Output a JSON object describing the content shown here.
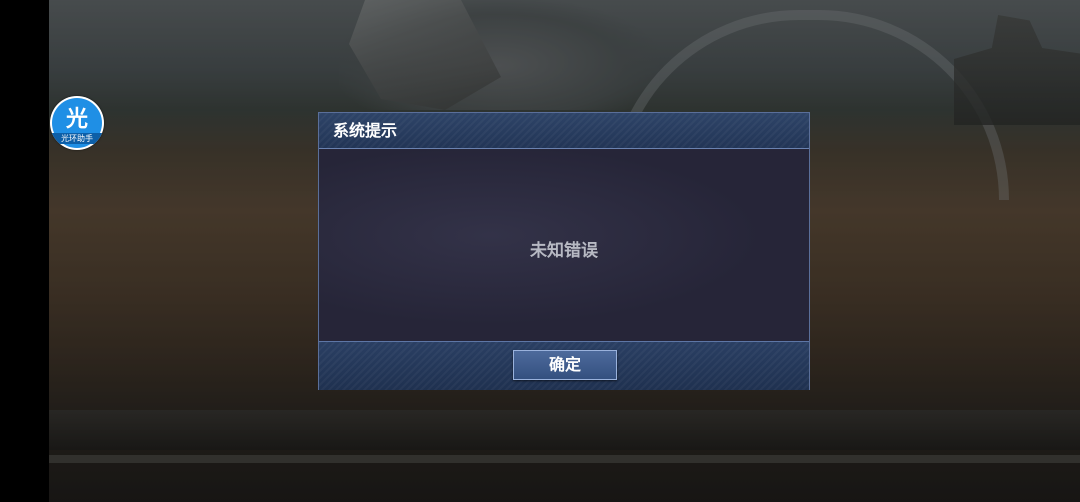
{
  "helper_badge": {
    "glyph": "光",
    "caption": "光环助手",
    "color": "#1f8fe5"
  },
  "dialog": {
    "title": "系统提示",
    "message": "未知错误",
    "confirm_label": "确定",
    "header_color": "#2e4468",
    "body_color": "#262538"
  }
}
